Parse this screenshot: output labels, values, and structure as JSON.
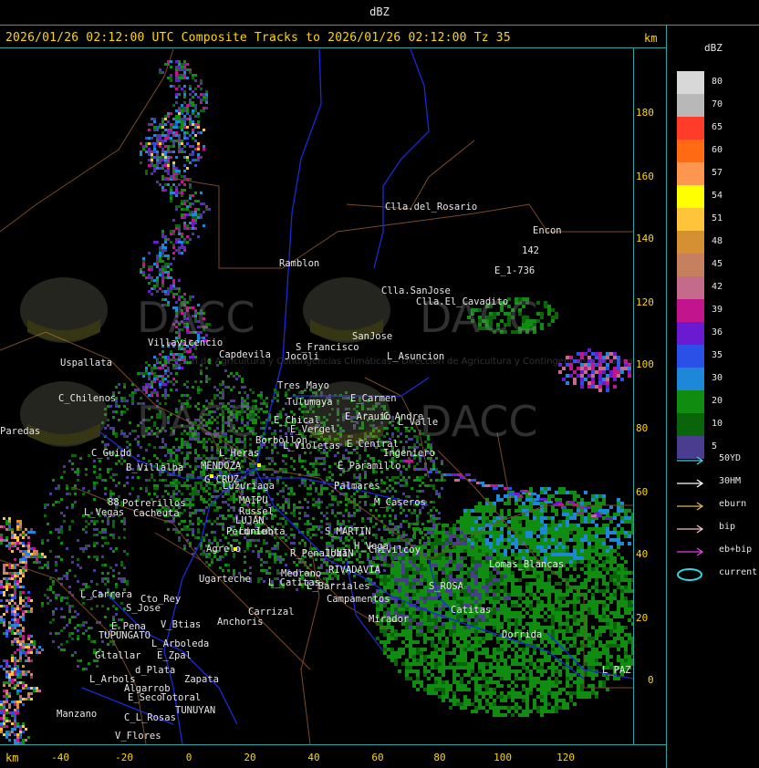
{
  "window": {
    "top_title": "dBZ",
    "header": "2026/01/26 02:12:00 UTC Composite Tracks to 2026/01/26 02:12:00 Tz 35",
    "unit_top": "km",
    "unit_bottom": "km"
  },
  "axes": {
    "y_ticks": [
      "180",
      "160",
      "140",
      "120",
      "100",
      "80",
      "60",
      "40",
      "20",
      "0"
    ],
    "x_ticks": [
      "-40",
      "-20",
      "0",
      "20",
      "40",
      "60",
      "80",
      "100",
      "120"
    ]
  },
  "legend": {
    "title": "dBZ",
    "entries": [
      {
        "label": "80",
        "color": "#d8d8d8"
      },
      {
        "label": "70",
        "color": "#b8b8b8"
      },
      {
        "label": "65",
        "color": "#ff3c2a"
      },
      {
        "label": "60",
        "color": "#ff6a12"
      },
      {
        "label": "57",
        "color": "#ff9650"
      },
      {
        "label": "54",
        "color": "#ffff00"
      },
      {
        "label": "51",
        "color": "#ffc43a"
      },
      {
        "label": "48",
        "color": "#d69034"
      },
      {
        "label": "45",
        "color": "#c68060"
      },
      {
        "label": "42",
        "color": "#c46a8a"
      },
      {
        "label": "39",
        "color": "#c2148c"
      },
      {
        "label": "36",
        "color": "#6a1ad0"
      },
      {
        "label": "35",
        "color": "#2a50e8"
      },
      {
        "label": "30",
        "color": "#1e88d8"
      },
      {
        "label": "20",
        "color": "#108c10"
      },
      {
        "label": "10",
        "color": "#0a640a"
      },
      {
        "label": "5",
        "color": "#4a3c8e"
      }
    ],
    "tracks": [
      {
        "label": "50YD",
        "color": "#40d0d0",
        "icon": "arrow-right-icon"
      },
      {
        "label": "30HM",
        "color": "#ffffff",
        "icon": "arrow-right-icon"
      },
      {
        "label": "eburn",
        "color": "#e0b060",
        "icon": "arrow-right-icon"
      },
      {
        "label": "bip",
        "color": "#f0c0d0",
        "icon": "arrow-right-icon"
      },
      {
        "label": "eb+bip",
        "color": "#e040e0",
        "icon": "arrow-right-icon"
      },
      {
        "label": "current",
        "color": "#30d8e0",
        "icon": "ellipse-icon"
      }
    ]
  },
  "watermark": {
    "brand": "DACC",
    "subtitle": "Dirección de Agricultura y Contingencias Climáticas"
  },
  "places": [
    {
      "name": "Clla.del_Rosario"
    },
    {
      "name": "Encon"
    },
    {
      "name": "142"
    },
    {
      "name": "E_1-736"
    },
    {
      "name": "Ramblon"
    },
    {
      "name": "Clla.SanJose"
    },
    {
      "name": "Clla.El_Cavadito"
    },
    {
      "name": "Villavicencio"
    },
    {
      "name": "Capdevila"
    },
    {
      "name": "S_Francisco"
    },
    {
      "name": "Jocoli"
    },
    {
      "name": "SanJose"
    },
    {
      "name": "L_Asuncion"
    },
    {
      "name": "Uspallata"
    },
    {
      "name": "Tres_Mayo"
    },
    {
      "name": "Tulumaya"
    },
    {
      "name": "E_Carmen"
    },
    {
      "name": "C_Chilenos"
    },
    {
      "name": "E_Chical"
    },
    {
      "name": "E_Vergel"
    },
    {
      "name": "E_Arauio"
    },
    {
      "name": "C_Andre"
    },
    {
      "name": "L_Valle"
    },
    {
      "name": "Paredas"
    },
    {
      "name": "Borbollon"
    },
    {
      "name": "L_Violetas"
    },
    {
      "name": "E_Central"
    },
    {
      "name": "Ingeniero"
    },
    {
      "name": "C_Guido"
    },
    {
      "name": "L_Heras"
    },
    {
      "name": "E_Paramillo"
    },
    {
      "name": "B_Villalba"
    },
    {
      "name": "MENDOZA"
    },
    {
      "name": "G_CRUZ"
    },
    {
      "name": "Luzuriaga"
    },
    {
      "name": "Palmares"
    },
    {
      "name": "Potrerillos"
    },
    {
      "name": "L_Vegas"
    },
    {
      "name": "Cacheuta"
    },
    {
      "name": "MAIPU"
    },
    {
      "name": "Russel"
    },
    {
      "name": "M_Caseros"
    },
    {
      "name": "LUJAN"
    },
    {
      "name": "Lunlunta"
    },
    {
      "name": "Perdriel"
    },
    {
      "name": "S_MARTIN"
    },
    {
      "name": "Agrelo"
    },
    {
      "name": "H_Vega"
    },
    {
      "name": "Chivilcoy"
    },
    {
      "name": "R_Penaloza"
    },
    {
      "name": "JUNIN"
    },
    {
      "name": "Lomas_Blancas"
    },
    {
      "name": "Ugarteche"
    },
    {
      "name": "Medrano"
    },
    {
      "name": "RIVADAVIA"
    },
    {
      "name": "L_Catitas"
    },
    {
      "name": "L_Barriales"
    },
    {
      "name": "S_ROSA"
    },
    {
      "name": "L_Carrera"
    },
    {
      "name": "Cto_Rey"
    },
    {
      "name": "S_Jose"
    },
    {
      "name": "Carrizal"
    },
    {
      "name": "Campamentos"
    },
    {
      "name": "Catitas"
    },
    {
      "name": "Mirador"
    },
    {
      "name": "E_Pena"
    },
    {
      "name": "V_Btias"
    },
    {
      "name": "Anchoris"
    },
    {
      "name": "TUPUNGATO"
    },
    {
      "name": "Dorrida"
    },
    {
      "name": "L_Arboleda"
    },
    {
      "name": "Gltallar"
    },
    {
      "name": "E_Zpal"
    },
    {
      "name": "d_Plata"
    },
    {
      "name": "L_Arbols"
    },
    {
      "name": "Zapata"
    },
    {
      "name": "Algarrob"
    },
    {
      "name": "E_Seco"
    },
    {
      "name": "Totoral"
    },
    {
      "name": "L_PAZ"
    },
    {
      "name": "TUNUYAN"
    },
    {
      "name": "Manzano"
    },
    {
      "name": "C_L_Rosas"
    },
    {
      "name": "V_Flores"
    },
    {
      "name": "88"
    }
  ]
}
